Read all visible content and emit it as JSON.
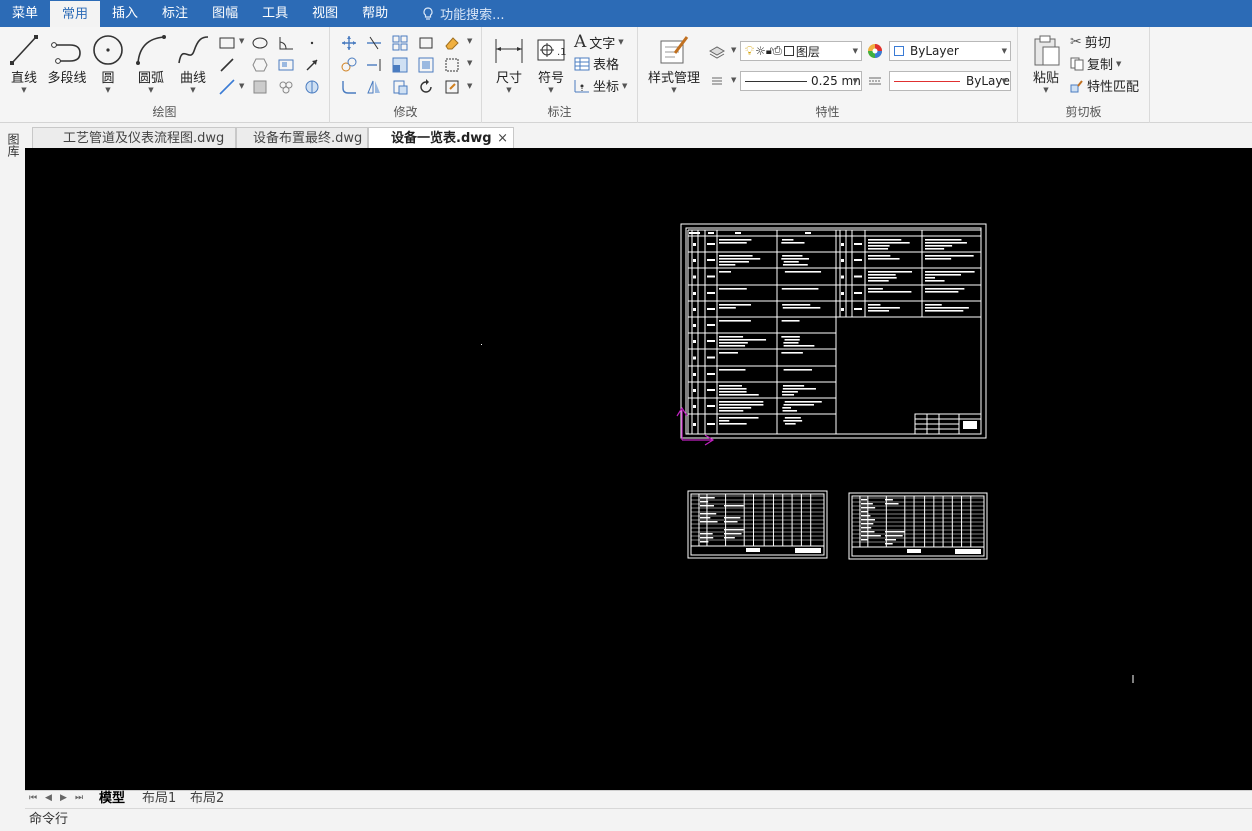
{
  "menu": {
    "tabs": [
      "菜单",
      "常用",
      "插入",
      "标注",
      "图幅",
      "工具",
      "视图",
      "帮助"
    ],
    "search_placeholder": "功能搜索..."
  },
  "ribbon": {
    "draw": {
      "title": "绘图",
      "line": "直线",
      "polyline": "多段线",
      "circle": "圆",
      "arc": "圆弧",
      "curve": "曲线"
    },
    "modify": {
      "title": "修改"
    },
    "annotate": {
      "title": "标注",
      "dimension": "尺寸",
      "symbol": "符号",
      "text": "文字",
      "table": "表格",
      "coordinate": "坐标"
    },
    "properties": {
      "title": "特性",
      "style_manager": "样式管理",
      "layer": "图层",
      "color": "ByLayer",
      "lineweight": "0.25 mn",
      "linetype": "ByLaye"
    },
    "clipboard": {
      "title": "剪切板",
      "paste": "粘贴",
      "cut": "剪切",
      "copy": "复制",
      "match": "特性匹配"
    }
  },
  "doc_tabs": [
    "工艺管道及仪表流程图.dwg",
    "设备布置最终.dwg",
    "设备一览表.dwg"
  ],
  "active_doc_tab": "设备一览表.dwg",
  "left_toolbar": {
    "label": "图库"
  },
  "layout_tabs": [
    "模型",
    "布局1",
    "布局2"
  ],
  "command_line": "命令行",
  "colors": {
    "menubar": "#2c6bb6",
    "canvas": "#000000",
    "ucs": "#c020c0",
    "linetype_red": "#e03030"
  }
}
